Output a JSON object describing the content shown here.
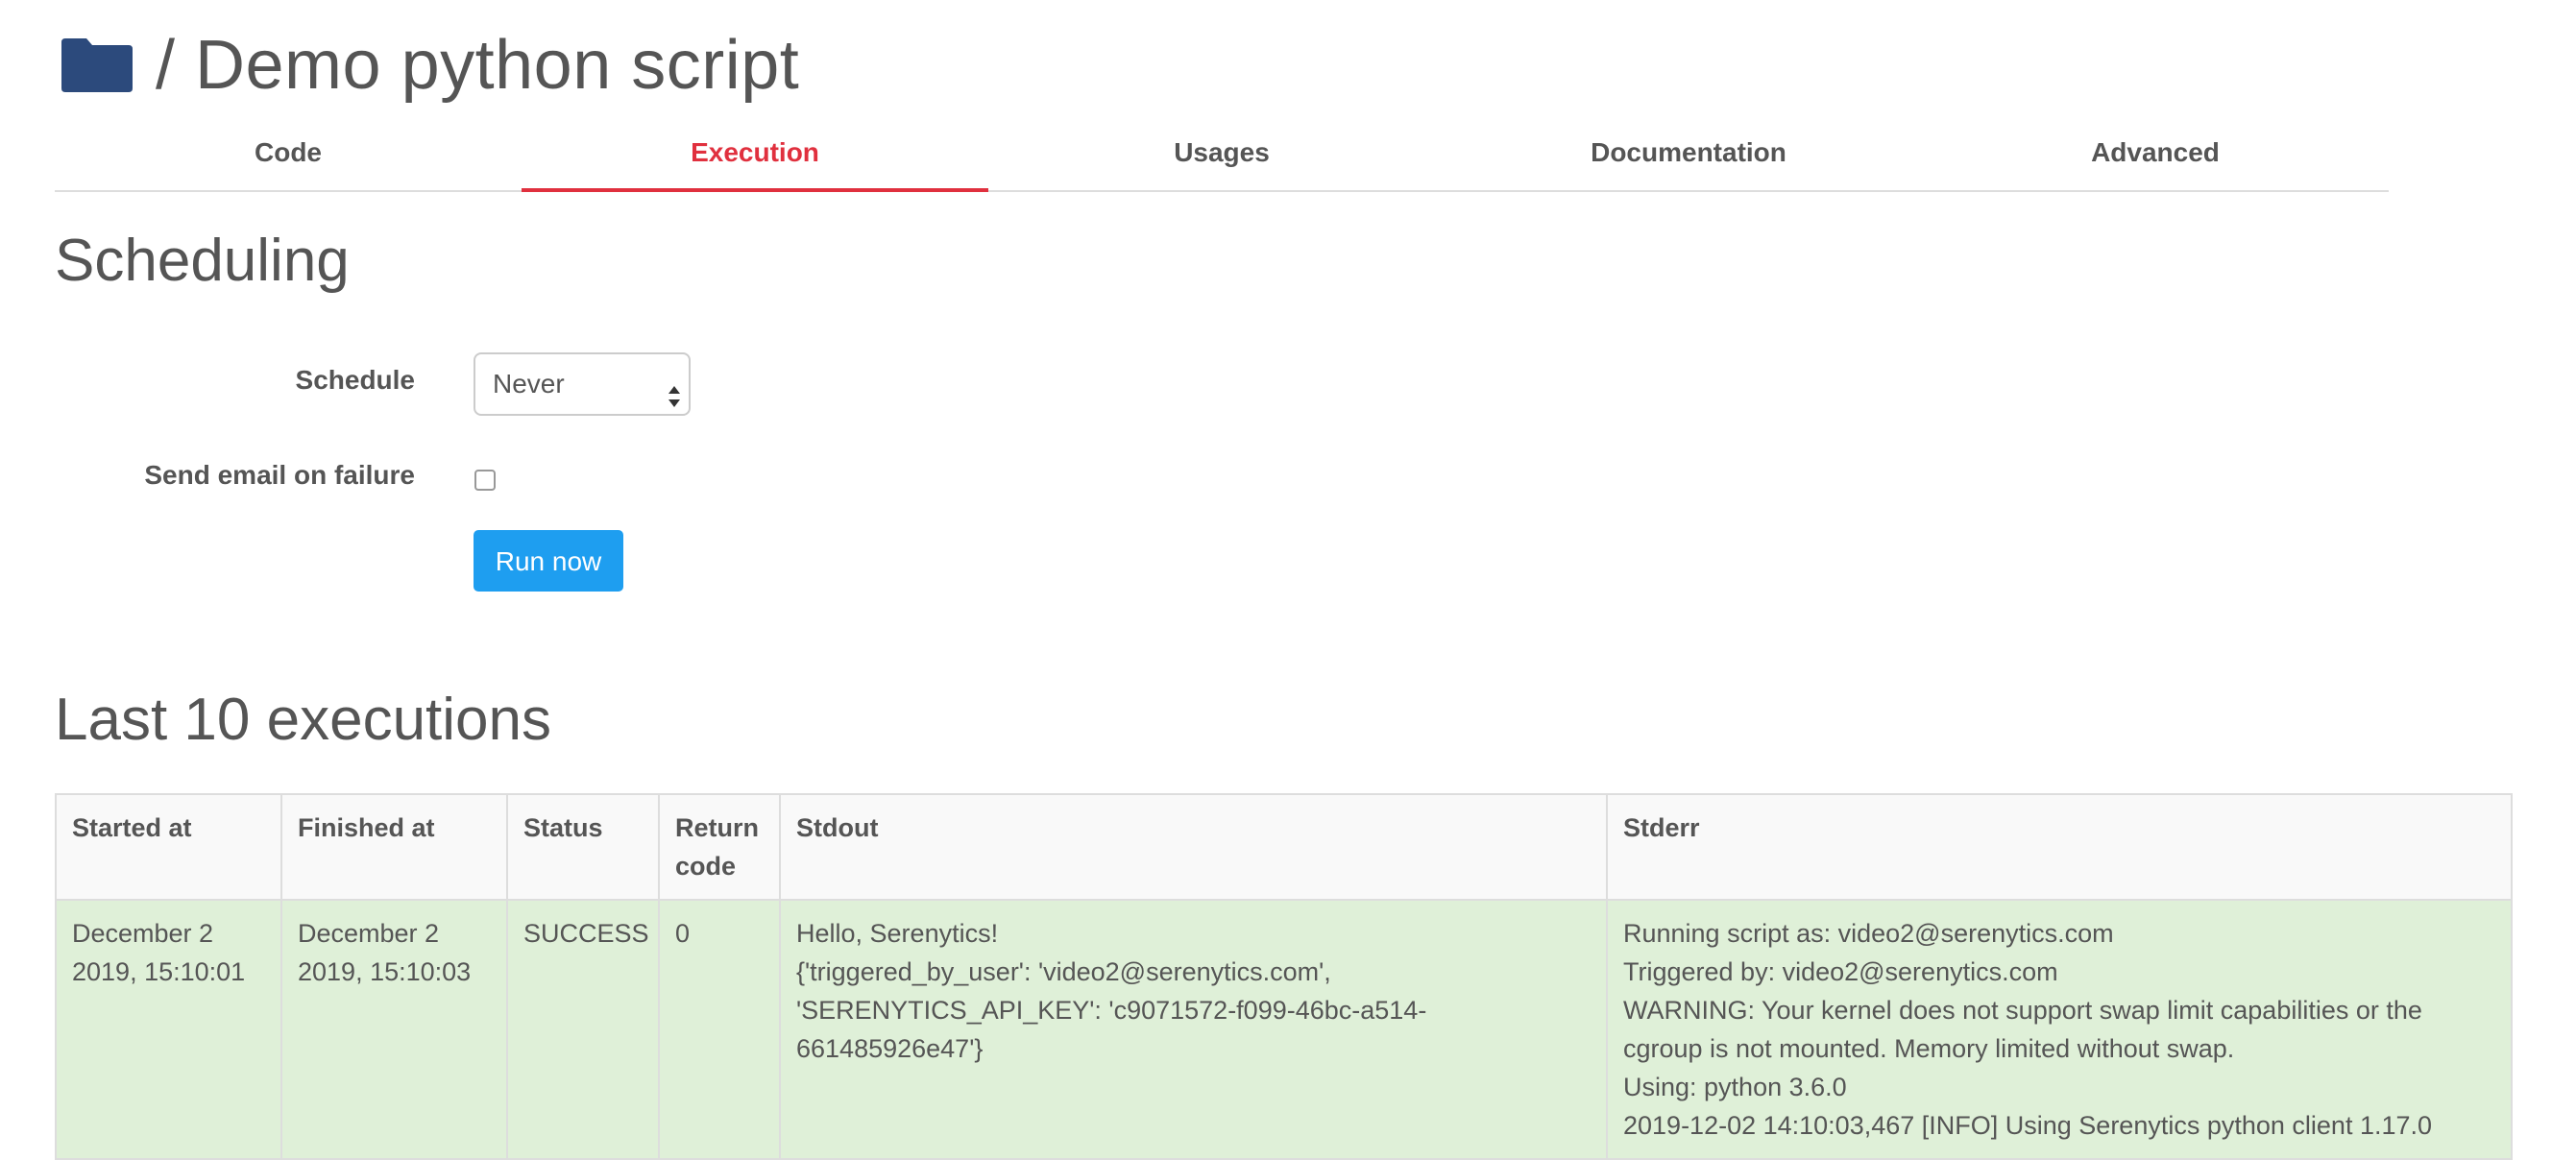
{
  "header": {
    "title": "/ Demo python script",
    "icon": "folder-icon",
    "icon_color": "#2c4a7c"
  },
  "tabs": [
    {
      "label": "Code",
      "active": false
    },
    {
      "label": "Execution",
      "active": true
    },
    {
      "label": "Usages",
      "active": false
    },
    {
      "label": "Documentation",
      "active": false
    },
    {
      "label": "Advanced",
      "active": false
    }
  ],
  "accent_color": "#e0303e",
  "scheduling": {
    "heading": "Scheduling",
    "schedule_label": "Schedule",
    "schedule_value": "Never",
    "email_label": "Send email on failure",
    "email_checked": false,
    "run_button": "Run now",
    "run_button_color": "#1e9ef0"
  },
  "executions": {
    "heading": "Last 10 executions",
    "columns": [
      "Started at",
      "Finished at",
      "Status",
      "Return code",
      "Stdout",
      "Stderr"
    ],
    "rows": [
      {
        "started": [
          "December 2",
          "2019, 15:10:01"
        ],
        "finished": [
          "December 2",
          "2019, 15:10:03"
        ],
        "status": "SUCCESS",
        "return_code": "0",
        "stdout": [
          "Hello, Serenytics!",
          "{'triggered_by_user': 'video2@serenytics.com',",
          "'SERENYTICS_API_KEY': 'c9071572-f099-46bc-a514-",
          "661485926e47'}"
        ],
        "stderr": [
          "Running script as: video2@serenytics.com",
          "Triggered by: video2@serenytics.com",
          "WARNING: Your kernel does not support swap limit capabilities or the",
          "cgroup is not mounted. Memory limited without swap.",
          "Using: python 3.6.0",
          "2019-12-02 14:10:03,467 [INFO] Using Serenytics python client 1.17.0"
        ]
      }
    ]
  }
}
